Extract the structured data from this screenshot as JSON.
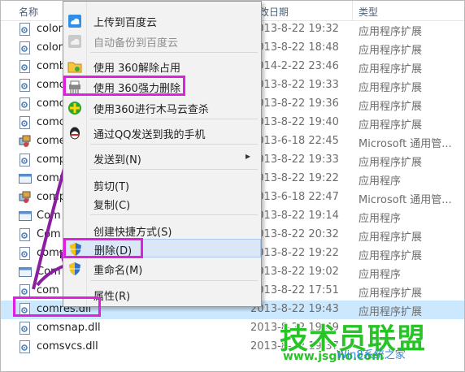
{
  "header": {
    "col_name": "名称",
    "col_date": "改日期",
    "col_type": "类型"
  },
  "files": [
    {
      "name": "color",
      "date": "2013-8-22 19:32",
      "type": "应用程序扩展",
      "icon": "dll-file-icon"
    },
    {
      "name": "colorui",
      "date": "2013-8-22 18:48",
      "type": "应用程序扩展",
      "icon": "dll-file-icon"
    },
    {
      "name": "comb",
      "date": "2014-2-22 23:46",
      "type": "应用程序扩展",
      "icon": "dll-file-icon"
    },
    {
      "name": "comc",
      "date": "2013-8-22 19:33",
      "type": "应用程序扩展",
      "icon": "dll-file-icon"
    },
    {
      "name": "comc",
      "date": "2013-8-22 19:36",
      "type": "应用程序扩展",
      "icon": "dll-file-icon"
    },
    {
      "name": "comc",
      "date": "2013-8-22 19:40",
      "type": "应用程序扩展",
      "icon": "dll-file-icon"
    },
    {
      "name": "come",
      "date": "2013-6-18 22:45",
      "type": "Microsoft 通用管...",
      "icon": "msc-file-icon"
    },
    {
      "name": "comp",
      "date": "2013-8-22 19:33",
      "type": "应用程序扩展",
      "icon": "dll-file-icon"
    },
    {
      "name": "comp",
      "date": "2013-8-22 19:22",
      "type": "应用程序",
      "icon": "exe-file-icon"
    },
    {
      "name": "comp",
      "date": "2013-6-18 22:47",
      "type": "Microsoft 通用管...",
      "icon": "msc-file-icon"
    },
    {
      "name": "Com",
      "date": "2013-8-22 19:14",
      "type": "应用程序",
      "icon": "exe-file-icon"
    },
    {
      "name": "Com",
      "date": "2013-8-22 20:32",
      "type": "应用程序扩展",
      "icon": "dll-file-icon"
    },
    {
      "name": "comp",
      "date": "2013-8-22 19:22",
      "type": "应用程序扩展",
      "icon": "dll-file-icon"
    },
    {
      "name": "Com",
      "date": "2013-8-22 19:02",
      "type": "应用程序",
      "icon": "exe-file-icon"
    },
    {
      "name": "com",
      "date": "2013-8-22 17:51",
      "type": "应用程序扩展",
      "icon": "dll-file-icon"
    },
    {
      "name": "comres.dll",
      "date": "2013-8-22 19:43",
      "type": "应用程序扩展",
      "icon": "dll-file-icon"
    },
    {
      "name": "comsnap.dll",
      "date": "2013-8-22 19:49",
      "type": "",
      "icon": "dll-file-icon"
    },
    {
      "name": "comsvcs.dll",
      "date": "2013-8-22 19:37",
      "type": "",
      "icon": "dll-file-icon"
    }
  ],
  "menu": {
    "items": [
      {
        "label": "上传到百度云",
        "icon": "baidu-cloud-icon",
        "disabled": false
      },
      {
        "label": "自动备份到百度云",
        "icon": "baidu-backup-icon",
        "disabled": true
      },
      {
        "label": "使用 360解除占用",
        "icon": "folder-360-icon",
        "disabled": false
      },
      {
        "label": "使用 360强力删除",
        "icon": "shredder-360-icon",
        "disabled": false
      },
      {
        "label": "使用360进行木马云查杀",
        "icon": "shield-360-icon",
        "disabled": false
      },
      {
        "label": "通过QQ发送到我的手机",
        "icon": "qq-icon",
        "disabled": false
      },
      {
        "label": "发送到(N)",
        "icon": "",
        "disabled": false,
        "submenu_arrow": "▸"
      },
      {
        "label": "剪切(T)",
        "icon": "",
        "disabled": false
      },
      {
        "label": "复制(C)",
        "icon": "",
        "disabled": false
      },
      {
        "label": "创建快捷方式(S)",
        "icon": "",
        "disabled": false
      },
      {
        "label": "删除(D)",
        "icon": "uac-shield-icon",
        "disabled": false
      },
      {
        "label": "重命名(M)",
        "icon": "uac-shield-icon",
        "disabled": false
      },
      {
        "label": "属性(R)",
        "icon": "",
        "disabled": false
      }
    ]
  },
  "watermark": {
    "brand": "技术员联盟",
    "url": "www.jsgho.com",
    "sub": "Win8系统之家"
  },
  "colors": {
    "highlight": "#e020e0",
    "arrow": "#8a1fa0",
    "selection": "#cce8ff",
    "menu_hover": "#dbe7f7",
    "watermark": "#27c327"
  }
}
